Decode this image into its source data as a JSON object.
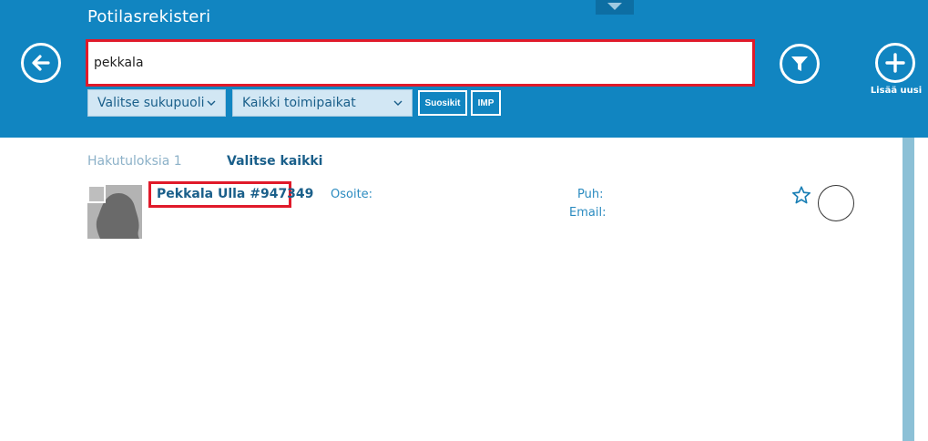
{
  "header": {
    "title": "Potilasrekisteri",
    "add_label": "Lisää uusi",
    "color": "#1185c1"
  },
  "search": {
    "value": "pekkala"
  },
  "filters": {
    "gender": "Valitse sukupuoli",
    "location": "Kaikki toimipaikat",
    "favorites": "Suosikit",
    "imp": "IMP"
  },
  "results": {
    "count_label": "Hakutuloksia 1",
    "select_all": "Valitse kaikki",
    "items": [
      {
        "name": "Pekkala Ulla #947349",
        "address_label": "Osoite:",
        "phone_label": "Puh:",
        "email_label": "Email:"
      }
    ]
  },
  "icons": {
    "back": "arrow-left-icon",
    "filter": "funnel-icon",
    "add": "plus-icon",
    "favorite": "star-icon"
  }
}
